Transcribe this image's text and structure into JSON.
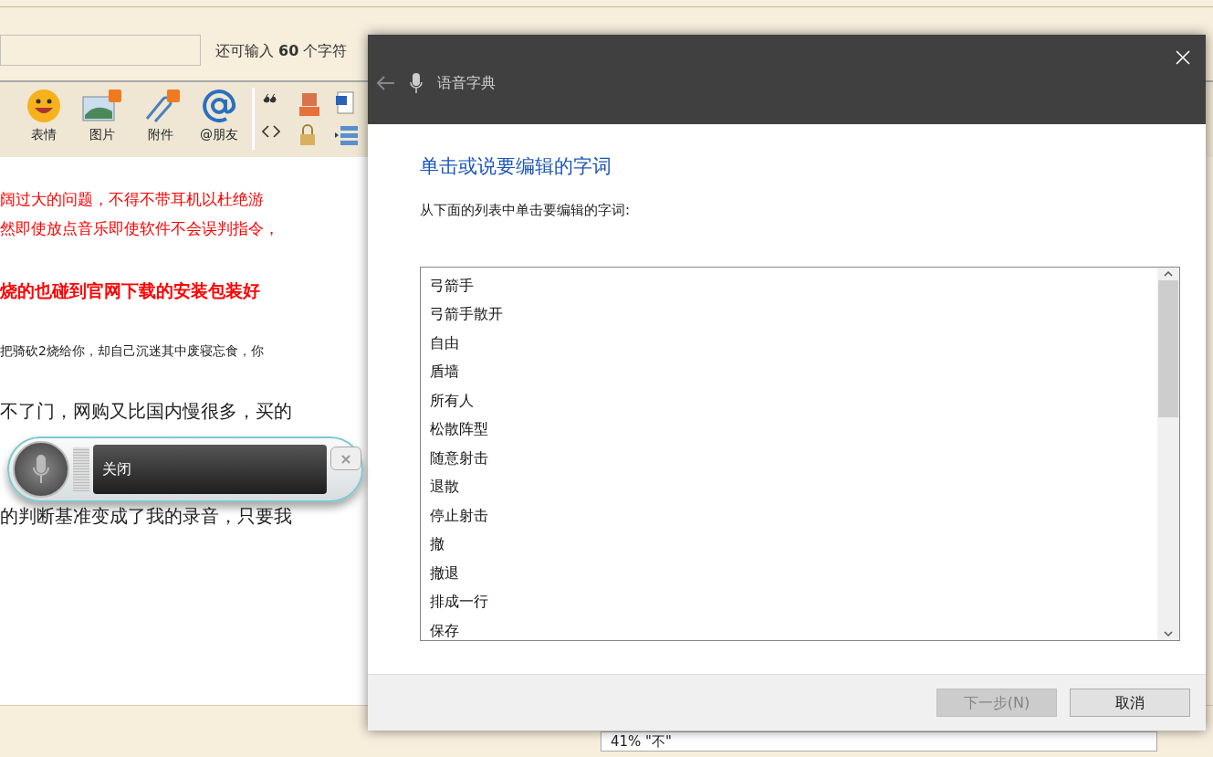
{
  "forum": {
    "input_counter": "还可输入 **60** 个字符",
    "toolbar": [
      {
        "kind": "smiley",
        "label": "表情"
      },
      {
        "kind": "picture",
        "label": "图片"
      },
      {
        "kind": "attachment",
        "label": "附件"
      },
      {
        "kind": "at",
        "label": "@朋友"
      }
    ],
    "paragraphs": [
      {
        "kind": "red",
        "text": "阔过大的问题，不得不带耳机以杜绝游"
      },
      {
        "kind": "red",
        "text": "然即使放点音乐即使软件不会误判指令，"
      },
      {
        "kind": "redbold",
        "text": "烧的也碰到官网下载的安装包装好"
      },
      {
        "kind": "small",
        "text": "把骑砍2烧给你，却自己沉迷其中废寝忘食，你"
      },
      {
        "kind": "large",
        "text": "不了门，网购又比国内慢很多，买的"
      },
      {
        "kind": "gap"
      },
      {
        "kind": "large",
        "text": "的判断基准变成了我的录音，只要我"
      }
    ],
    "tooltip": "41% \"不\""
  },
  "speech_bar": {
    "status": "关闭"
  },
  "dialog": {
    "title": "语音字典",
    "heading": "单击或说要编辑的字词",
    "instruction": "从下面的列表中单击要编辑的字词:",
    "items": [
      {
        "text": "弓箭手",
        "selected": false
      },
      {
        "text": "弓箭手散开",
        "selected": false
      },
      {
        "text": "自由",
        "selected": false
      },
      {
        "text": "盾墙",
        "selected": false
      },
      {
        "text": "所有人",
        "selected": false
      },
      {
        "text": "松散阵型",
        "selected": false
      },
      {
        "text": "随意射击",
        "selected": false
      },
      {
        "text": "退散",
        "selected": false
      },
      {
        "text": "停止射击",
        "selected": false
      },
      {
        "text": "撤",
        "selected": false
      },
      {
        "text": "撤退",
        "selected": false
      },
      {
        "text": "排成一行",
        "selected": false
      },
      {
        "text": "保存",
        "selected": false
      }
    ],
    "buttons": [
      {
        "label": "下一步(N)",
        "disabled": true
      },
      {
        "label": "取消",
        "disabled": false
      }
    ]
  }
}
